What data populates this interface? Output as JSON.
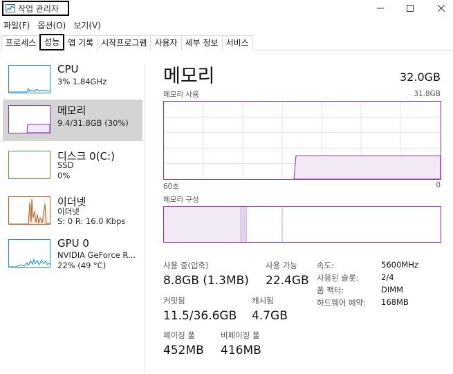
{
  "window": {
    "title": "작업 관리자",
    "icon": "task-manager-icon",
    "controls": [
      "minimize-icon",
      "maximize-icon",
      "close-icon"
    ]
  },
  "menu": [
    "파일(F)",
    "옵션(O)",
    "보기(V)"
  ],
  "tabs": [
    {
      "label": "프로세스",
      "active": false
    },
    {
      "label": "성능",
      "active": true
    },
    {
      "label": "앱 기록",
      "active": false
    },
    {
      "label": "시작프로그램",
      "active": false
    },
    {
      "label": "사용자",
      "active": false
    },
    {
      "label": "세부 정보",
      "active": false
    },
    {
      "label": "서비스",
      "active": false
    }
  ],
  "sidebar": {
    "items": [
      {
        "name": "CPU",
        "line1": "3% 1.84GHz",
        "line2": "",
        "color": "#1a8fc6",
        "active": false
      },
      {
        "name": "메모리",
        "line1": "9.4/31.8GB (30%)",
        "line2": "",
        "color": "#8a2eb0",
        "active": true
      },
      {
        "name": "디스크 0(C:)",
        "line1": "SSD",
        "line2": "0%",
        "color": "#4da33a",
        "active": false
      },
      {
        "name": "이더넷",
        "line1": "이더넷",
        "line2": "S: 0 R: 16.0 Kbps",
        "color": "#b85c1f",
        "active": false
      },
      {
        "name": "GPU 0",
        "line1": "NVIDIA GeForce R...",
        "line2": "22% (49 °C)",
        "color": "#1a8fc6",
        "active": false
      }
    ]
  },
  "main": {
    "title": "메모리",
    "total": "32.0GB",
    "usage_graph": {
      "label": "메모리 사용",
      "max_label": "31.8GB",
      "time_left": "60초",
      "time_right": "0",
      "accent": "#8a2eb0",
      "current_fraction": 0.3
    },
    "composition": {
      "label": "메모리 구성"
    },
    "stats": {
      "in_use_label": "사용 중(압축)",
      "in_use_value": "8.8GB (1.3MB)",
      "available_label": "사용 가능",
      "available_value": "22.4GB",
      "committed_label": "커밋됨",
      "committed_value": "11.5/36.6GB",
      "cached_label": "캐시됨",
      "cached_value": "4.7GB",
      "paged_label": "페이징 풀",
      "paged_value": "452MB",
      "nonpaged_label": "비페이징 풀",
      "nonpaged_value": "416MB"
    },
    "details": [
      {
        "label": "속도:",
        "value": "5600MHz"
      },
      {
        "label": "사용된 슬롯:",
        "value": "2/4"
      },
      {
        "label": "폼 팩터:",
        "value": "DIMM"
      },
      {
        "label": "하드웨어 예약:",
        "value": "168MB"
      }
    ]
  }
}
